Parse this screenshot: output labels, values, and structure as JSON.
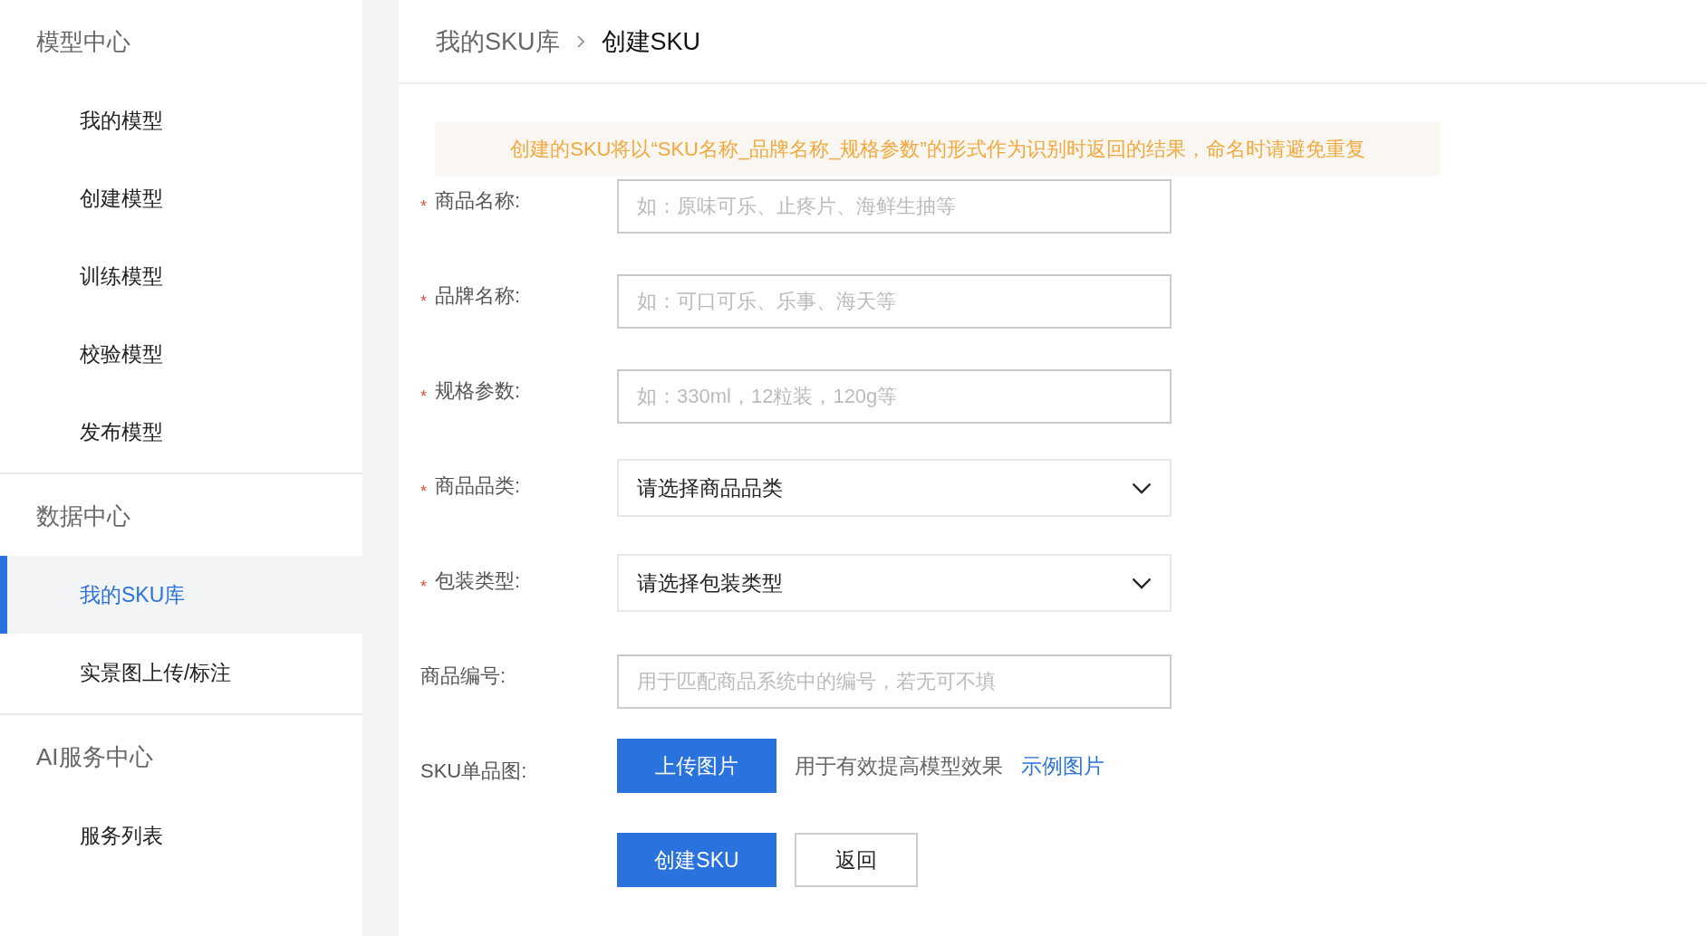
{
  "sidebar": {
    "sections": [
      {
        "title": "模型中心",
        "items": [
          {
            "label": "我的模型",
            "selected": false
          },
          {
            "label": "创建模型",
            "selected": false
          },
          {
            "label": "训练模型",
            "selected": false
          },
          {
            "label": "校验模型",
            "selected": false
          },
          {
            "label": "发布模型",
            "selected": false
          }
        ]
      },
      {
        "title": "数据中心",
        "items": [
          {
            "label": "我的SKU库",
            "selected": true
          },
          {
            "label": "实景图上传/标注",
            "selected": false
          }
        ]
      },
      {
        "title": "AI服务中心",
        "items": [
          {
            "label": "服务列表",
            "selected": false
          }
        ]
      }
    ]
  },
  "breadcrumb": [
    {
      "label": "我的SKU库",
      "current": false
    },
    {
      "label": "创建SKU",
      "current": true
    }
  ],
  "notice": "创建的SKU将以“SKU名称_品牌名称_规格参数”的形式作为识别时返回的结果，命名时请避免重复",
  "form": {
    "fields": [
      {
        "kind": "text",
        "label": "商品名称:",
        "marker": "*",
        "placeholder": "如：原味可乐、止疼片、海鲜生抽等"
      },
      {
        "kind": "text",
        "label": "品牌名称:",
        "marker": "*",
        "placeholder": "如：可口可乐、乐事、海天等"
      },
      {
        "kind": "text",
        "label": "规格参数:",
        "marker": "*",
        "placeholder": "如：330ml，12粒装，120g等"
      },
      {
        "kind": "select",
        "label": "商品品类:",
        "marker": "*",
        "value": "请选择商品品类"
      },
      {
        "kind": "select",
        "label": "包装类型:",
        "marker": "*",
        "value": "请选择包装类型"
      },
      {
        "kind": "text",
        "label": "商品编号:",
        "placeholder": "用于匹配商品系统中的编号，若无可不填"
      },
      {
        "kind": "upload",
        "label": "SKU单品图:",
        "button": "上传图片",
        "hint": "用于有效提高模型效果",
        "link": "示例图片"
      }
    ],
    "actions": [
      {
        "label": "创建SKU",
        "primary": true
      },
      {
        "label": "返回",
        "primary": false
      }
    ]
  }
}
